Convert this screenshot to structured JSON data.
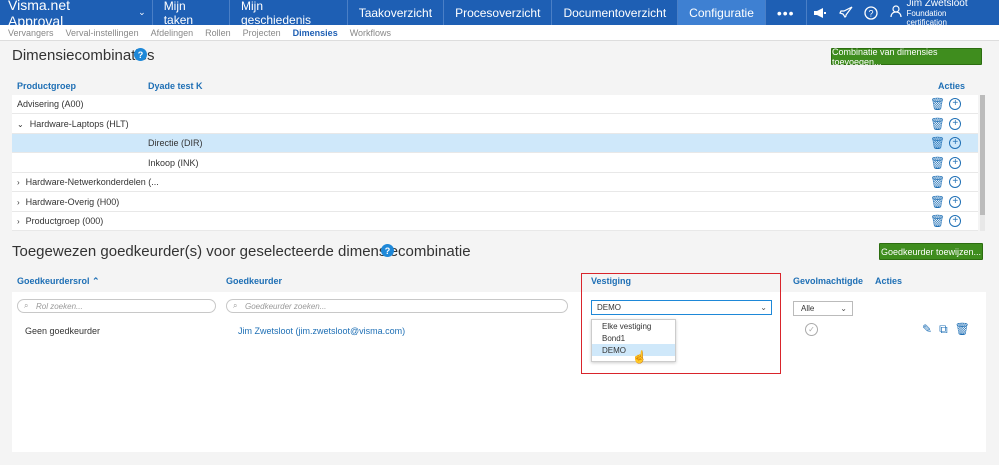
{
  "topbar": {
    "brand": "Visma.net Approval",
    "nav": [
      "Mijn taken",
      "Mijn geschiedenis",
      "Taakoverzicht",
      "Procesoverzicht",
      "Documentoverzicht",
      "Configuratie"
    ],
    "active_nav": "Configuratie",
    "more": "•••",
    "icons": [
      "announcement-icon",
      "rocket-icon",
      "help-icon",
      "user-icon"
    ],
    "user": {
      "name": "Jim Zwetsloot",
      "subtitle": "Foundation certification"
    }
  },
  "subnav": {
    "items": [
      "Vervangers",
      "Verval-instellingen",
      "Afdelingen",
      "Rollen",
      "Projecten",
      "Dimensies",
      "Workflows"
    ],
    "active": "Dimensies"
  },
  "section1": {
    "title": "Dimensiecombinaties",
    "help": "?",
    "button": "Combinatie van dimensies toevoegen...",
    "columns": {
      "col1": "Productgroep",
      "col2": "Dyade test K",
      "actions": "Acties"
    },
    "rows": [
      {
        "exp": "",
        "c1": "Advisering (A00)",
        "c2": ""
      },
      {
        "exp": "⌄",
        "c1": "Hardware-Laptops (HLT)",
        "c2": ""
      },
      {
        "exp": "",
        "c1": "",
        "c2": "Directie (DIR)"
      },
      {
        "exp": "",
        "c1": "",
        "c2": "Inkoop (INK)"
      },
      {
        "exp": "›",
        "c1": "Hardware-Netwerkonderdelen (...",
        "c2": ""
      },
      {
        "exp": "›",
        "c1": "Hardware-Overig (H00)",
        "c2": ""
      },
      {
        "exp": "›",
        "c1": "Productgroep (000)",
        "c2": ""
      }
    ],
    "selected_row": 2
  },
  "section2": {
    "title": "Toegewezen goedkeurder(s) voor geselecteerde dimensiecombinatie",
    "help": "?",
    "button": "Goedkeurder toewijzen...",
    "columns": {
      "role": "Goedkeurdersrol",
      "role_sort": "⌃",
      "approver": "Goedkeurder",
      "location": "Vestiging",
      "proxy": "Gevolmachtigde",
      "actions": "Acties"
    },
    "role_search_placeholder": "Rol zoeken...",
    "approver_search_placeholder": "Goedkeurder zoeken...",
    "location_selected": "DEMO",
    "location_options": [
      "Elke vestiging",
      "Bond1",
      "DEMO"
    ],
    "location_highlighted": "DEMO",
    "proxy_selected": "Alle",
    "row": {
      "role": "Geen goedkeurder",
      "approver": "Jim Zwetsloot (jim.zwetsloot@visma.com)"
    }
  },
  "colors": {
    "topbar": "#1e5fb4",
    "accent": "#1e6fb5",
    "green_button": "#3f8d1e",
    "selection": "#cfe8fa",
    "highlight_box": "#d9242b"
  }
}
